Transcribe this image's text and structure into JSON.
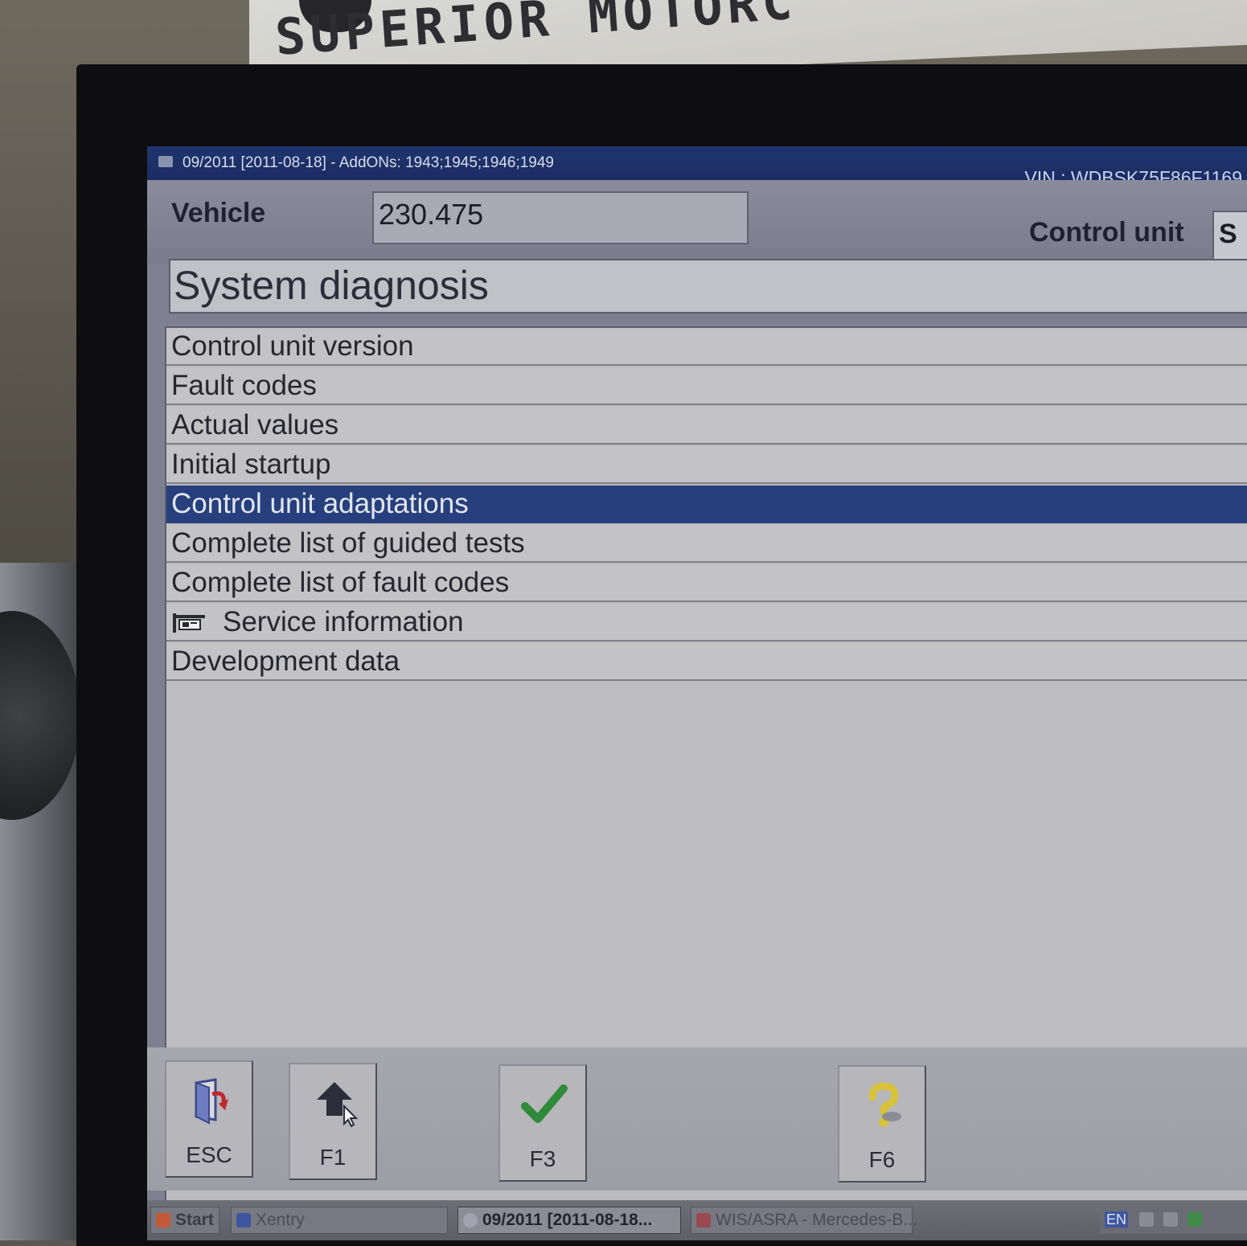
{
  "scene": {
    "banner_text": "SUPERIOR MOTORC"
  },
  "window": {
    "title": "09/2011 [2011-08-18] - AddONs: 1943;1945;1946;1949",
    "vin": "VIN : WDBSK75F86F1169"
  },
  "header": {
    "vehicle_label": "Vehicle",
    "vehicle_value": "230.475",
    "control_unit_label": "Control unit",
    "control_unit_value": "S"
  },
  "section": {
    "title": "System diagnosis"
  },
  "menu": {
    "items": [
      {
        "label": "Control unit version",
        "selected": false
      },
      {
        "label": "Fault codes",
        "selected": false
      },
      {
        "label": "Actual values",
        "selected": false
      },
      {
        "label": "Initial startup",
        "selected": false
      },
      {
        "label": "Control unit adaptations",
        "selected": true
      },
      {
        "label": "Complete list of guided tests",
        "selected": false
      },
      {
        "label": "Complete list of fault codes",
        "selected": false
      },
      {
        "label": "Service information",
        "selected": false,
        "icon": "service-info-icon"
      },
      {
        "label": "Development data",
        "selected": false
      }
    ]
  },
  "function_keys": [
    {
      "label": "ESC",
      "icon": "exit-door-icon"
    },
    {
      "label": "F1",
      "icon": "up-arrow-icon"
    },
    {
      "label": "F3",
      "icon": "checkmark-icon"
    },
    {
      "label": "F6",
      "icon": "help-question-icon"
    }
  ],
  "taskbar": {
    "start": "Start",
    "quicklaunch": "Xentry",
    "task_active": "09/2011 [2011-08-18...",
    "task_other": "WIS/ASRA - Mercedes-B...",
    "tray_lang": "EN"
  },
  "colors": {
    "titlebar": "#1f3470",
    "selection": "#273f7c",
    "checkmark": "#2f8a3a",
    "help": "#d7c23a"
  }
}
